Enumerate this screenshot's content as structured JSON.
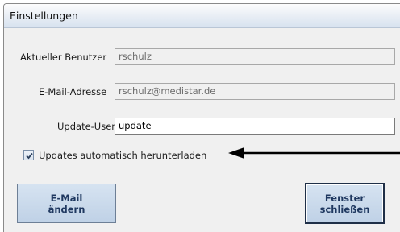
{
  "window": {
    "title": "Einstellungen"
  },
  "form": {
    "current_user": {
      "label": "Aktueller Benutzer",
      "value": "rschulz"
    },
    "email": {
      "label": "E-Mail-Adresse",
      "value": "rschulz@medistar.de"
    },
    "update_user": {
      "label": "Update-User",
      "value": "update"
    },
    "auto_update": {
      "label": "Updates automatisch herunterladen",
      "checked": true
    }
  },
  "buttons": {
    "change_email": "E-Mail\nändern",
    "close_window": "Fenster\nschließen"
  },
  "colors": {
    "button_text": "#1f3860",
    "button_bg": "#c9d9ec",
    "arrow": "#000000"
  },
  "icons": {
    "checkbox": "check-icon",
    "arrow": "arrow-left-icon"
  }
}
